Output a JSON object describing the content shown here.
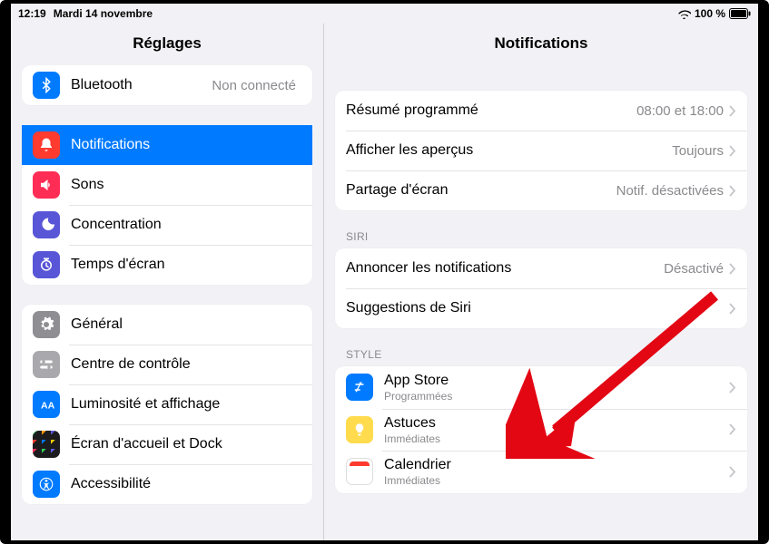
{
  "status": {
    "time": "12:19",
    "date": "Mardi 14 novembre",
    "battery_text": "100 %"
  },
  "sidebar": {
    "title": "Réglages",
    "groups": [
      {
        "rows": [
          {
            "key": "bluetooth",
            "label": "Bluetooth",
            "value": "Non connecté"
          }
        ]
      },
      {
        "rows": [
          {
            "key": "notifications",
            "label": "Notifications"
          },
          {
            "key": "sounds",
            "label": "Sons"
          },
          {
            "key": "focus",
            "label": "Concentration"
          },
          {
            "key": "screentime",
            "label": "Temps d'écran"
          }
        ]
      },
      {
        "rows": [
          {
            "key": "general",
            "label": "Général"
          },
          {
            "key": "controlcenter",
            "label": "Centre de contrôle"
          },
          {
            "key": "display",
            "label": "Luminosité et affichage"
          },
          {
            "key": "homescreen",
            "label": "Écran d'accueil et Dock"
          },
          {
            "key": "accessibility",
            "label": "Accessibilité"
          }
        ]
      }
    ]
  },
  "detail": {
    "title": "Notifications",
    "sections": [
      {
        "header": "",
        "rows": [
          {
            "key": "scheduled",
            "label": "Résumé programmé",
            "value": "08:00 et 18:00"
          },
          {
            "key": "previews",
            "label": "Afficher les aperçus",
            "value": "Toujours"
          },
          {
            "key": "screenshare",
            "label": "Partage d'écran",
            "value": "Notif. désactivées"
          }
        ]
      },
      {
        "header": "SIRI",
        "rows": [
          {
            "key": "announce",
            "label": "Annoncer les notifications",
            "value": "Désactivé"
          },
          {
            "key": "sirisuggest",
            "label": "Suggestions de Siri",
            "value": ""
          }
        ]
      },
      {
        "header": "STYLE",
        "rows": [
          {
            "key": "appstore",
            "label": "App Store",
            "sub": "Programmées"
          },
          {
            "key": "tips",
            "label": "Astuces",
            "sub": "Immédiates"
          },
          {
            "key": "calendar",
            "label": "Calendrier",
            "sub": "Immédiates"
          }
        ]
      }
    ]
  }
}
